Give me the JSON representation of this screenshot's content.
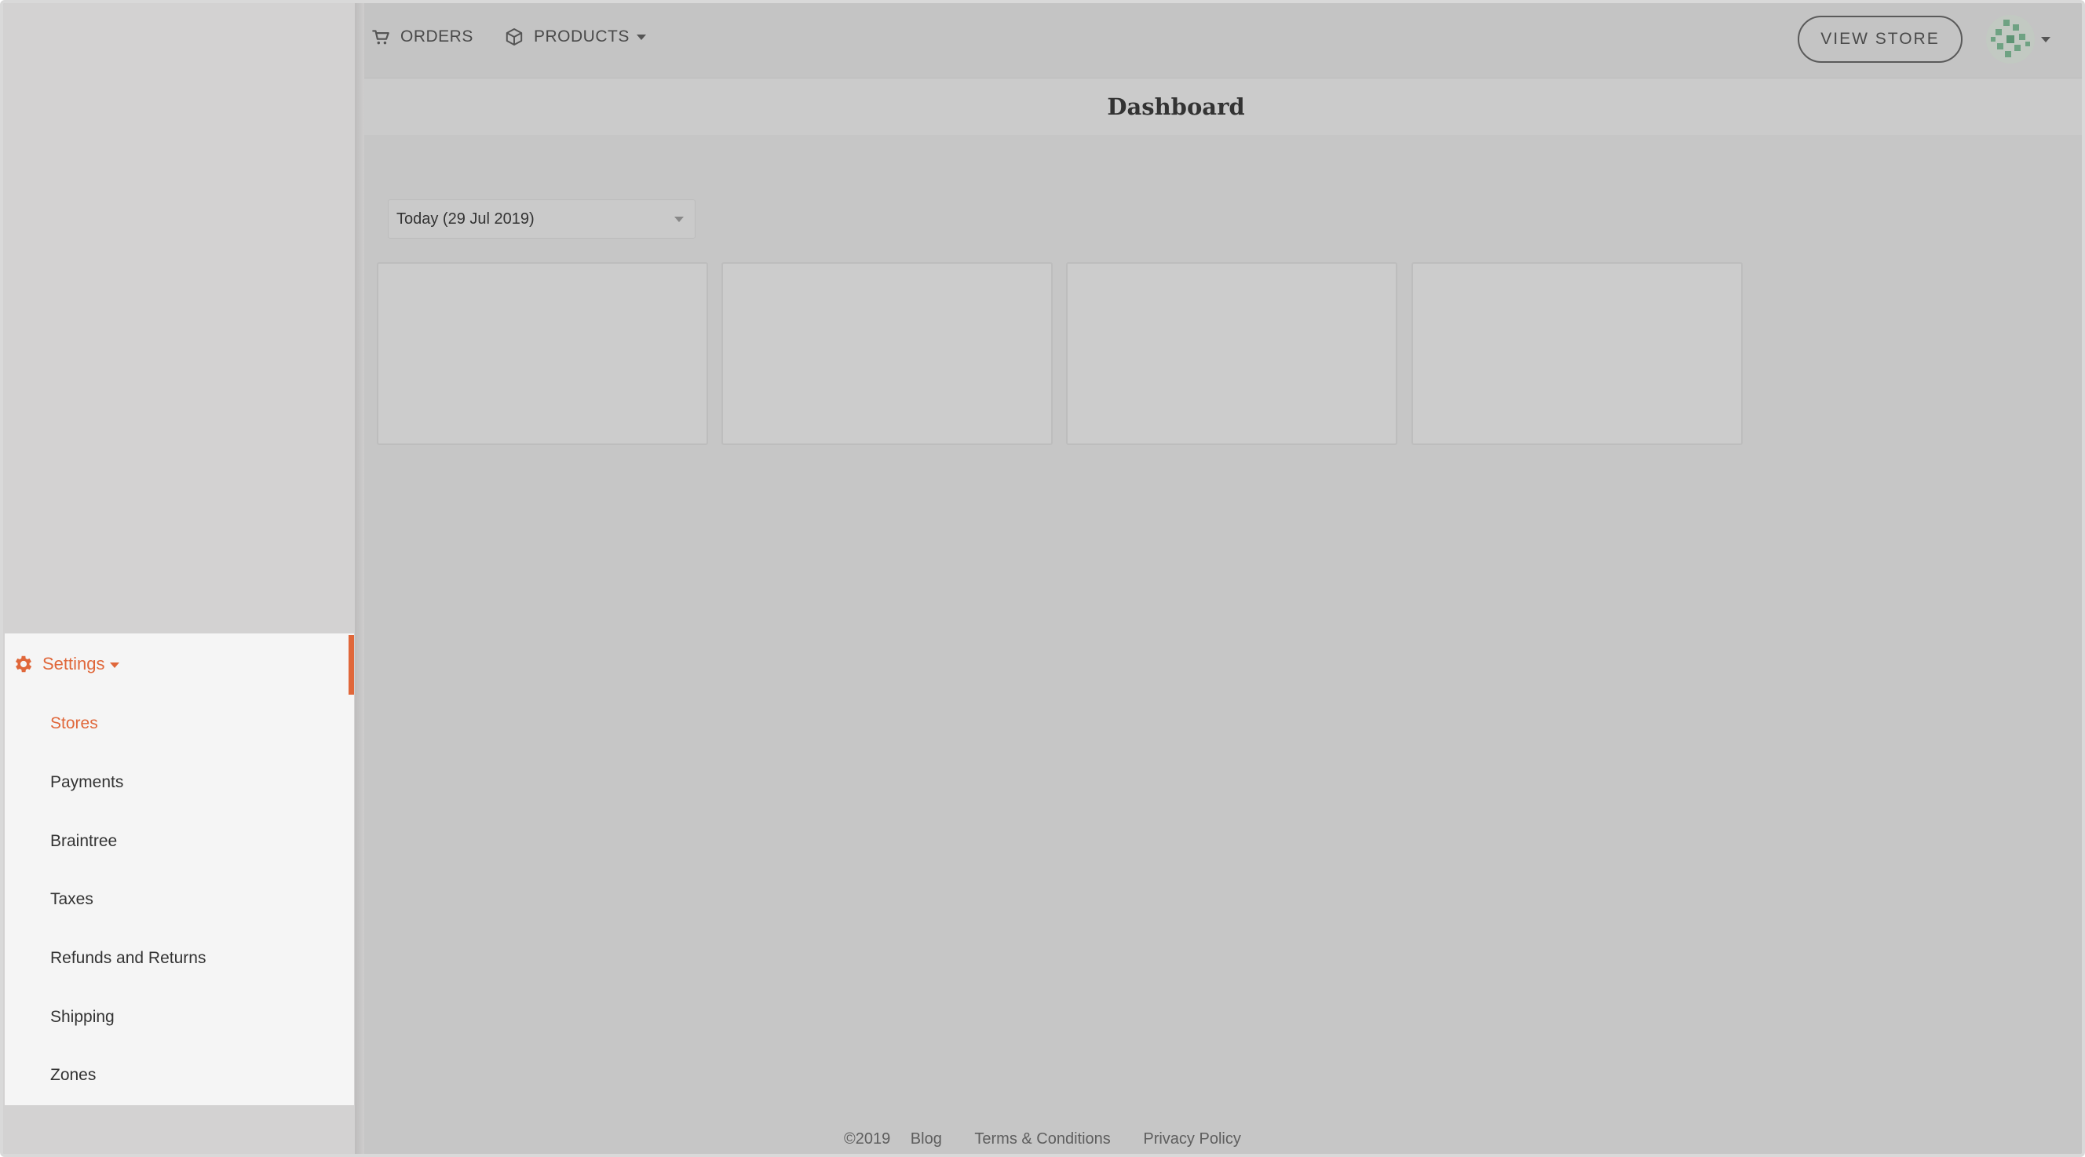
{
  "topnav": {
    "orders_label": "ORDERS",
    "products_label": "PRODUCTS",
    "view_store_label": "VIEW STORE"
  },
  "page": {
    "title": "Dashboard"
  },
  "filter": {
    "date_range_value": "Today (29 Jul 2019)"
  },
  "sidebar": {
    "settings_label": "Settings",
    "items": [
      {
        "label": "Stores",
        "active": true
      },
      {
        "label": "Payments",
        "active": false
      },
      {
        "label": "Braintree",
        "active": false
      },
      {
        "label": "Taxes",
        "active": false
      },
      {
        "label": "Refunds and Returns",
        "active": false
      },
      {
        "label": "Shipping",
        "active": false
      },
      {
        "label": "Zones",
        "active": false
      }
    ]
  },
  "footer": {
    "copyright": "©2019",
    "blog": "Blog",
    "terms": "Terms & Conditions",
    "privacy": "Privacy Policy"
  },
  "colors": {
    "accent": "#e0673a",
    "overlay": "#c6c6c6",
    "submenu_bg": "#f5f5f5"
  },
  "icons": {
    "orders": "cart-icon",
    "products": "box-icon",
    "settings": "gear-icon"
  }
}
